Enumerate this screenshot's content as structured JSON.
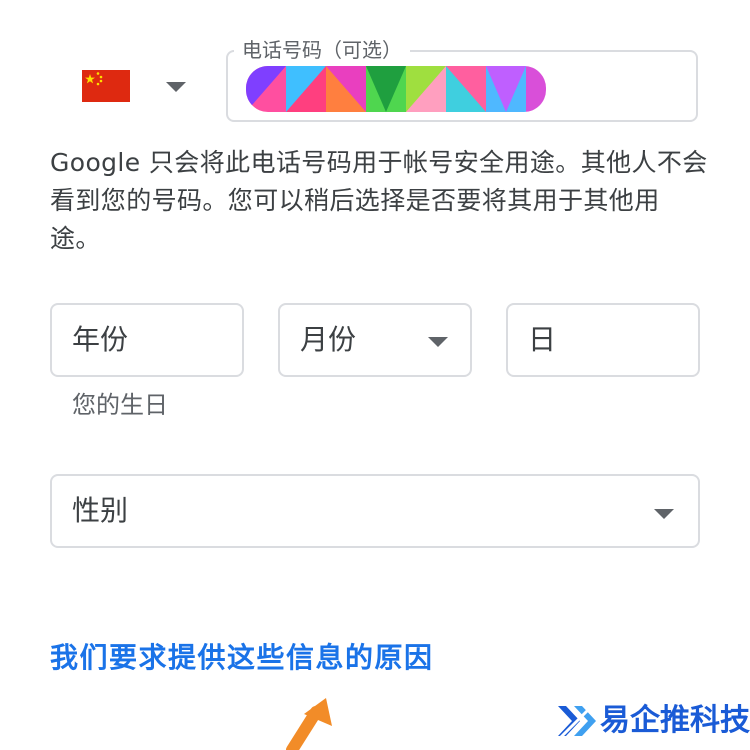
{
  "phone": {
    "country_flag": "china-flag-icon",
    "label": "电话号码（可选）",
    "value_obscured": true
  },
  "description": "Google 只会将此电话号码用于帐号安全用途。其他人不会看到您的号码。您可以稍后选择是否要将其用于其他用途。",
  "birthday": {
    "year_placeholder": "年份",
    "month_placeholder": "月份",
    "day_placeholder": "日",
    "helper": "您的生日"
  },
  "gender": {
    "placeholder": "性别"
  },
  "link": {
    "why_label": "我们要求提供这些信息的原因"
  },
  "watermark": {
    "text": "易企推科技"
  },
  "colors": {
    "link": "#1a73e8",
    "border": "#dadce0",
    "text": "#3c4043",
    "annotation_arrow": "#f28c28",
    "watermark": "#1a5bd6"
  }
}
